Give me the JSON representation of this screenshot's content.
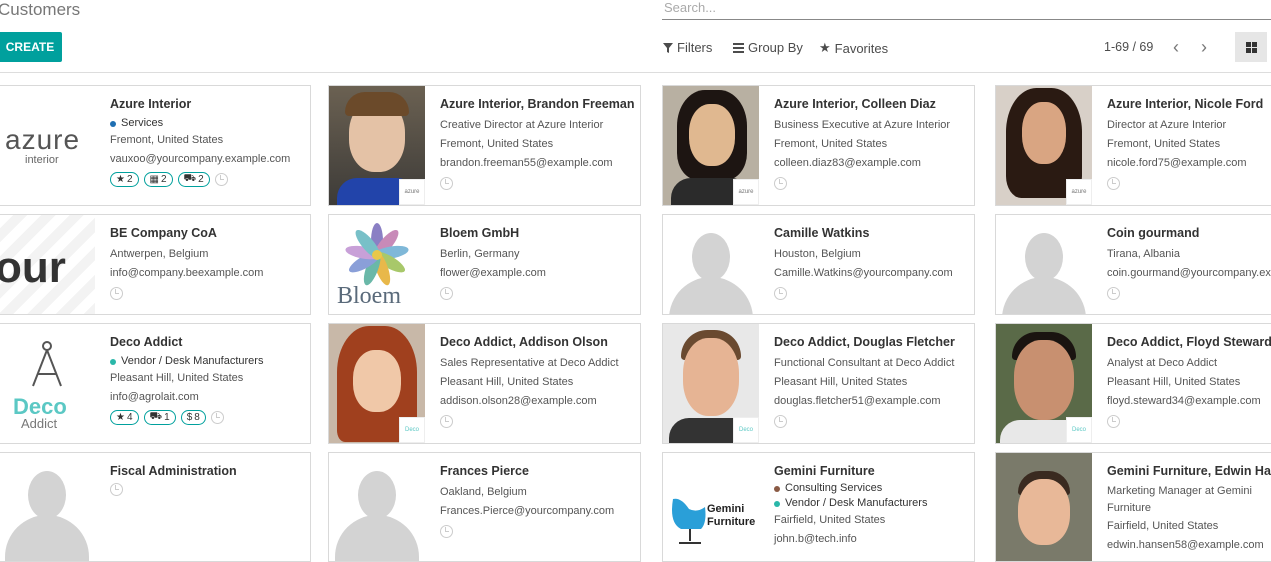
{
  "header": {
    "title": "Customers",
    "search_placeholder": "Search...",
    "create_label": "CREATE",
    "filters_label": "Filters",
    "groupby_label": "Group By",
    "favorites_label": "Favorites",
    "pager": "1-69 / 69"
  },
  "cards": [
    {
      "name": "Azure Interior",
      "tag": "Services",
      "tag_color": "#1f6fb2",
      "line1": "Fremont, United States",
      "line2": "vauxoo@yourcompany.example.com",
      "badges": [
        "2",
        "2",
        "2"
      ],
      "logo_text": "azure",
      "logo_sub": "interior"
    },
    {
      "name": "Azure Interior, Brandon Freeman",
      "line1": "Creative Director at Azure Interior",
      "line2": "Fremont, United States",
      "line3": "brandon.freeman55@example.com",
      "mini": "azure"
    },
    {
      "name": "Azure Interior, Colleen Diaz",
      "line1": "Business Executive at Azure Interior",
      "line2": "Fremont, United States",
      "line3": "colleen.diaz83@example.com",
      "mini": "azure"
    },
    {
      "name": "Azure Interior, Nicole Ford",
      "line1": "Director at Azure Interior",
      "line2": "Fremont, United States",
      "line3": "nicole.ford75@example.com",
      "mini": "azure"
    },
    {
      "name": "BE Company CoA",
      "line1": "Antwerpen, Belgium",
      "line2": "info@company.beexample.com",
      "logo_text": "our"
    },
    {
      "name": "Bloem GmbH",
      "line1": "Berlin, Germany",
      "line2": "flower@example.com",
      "logo_text": "Bloem"
    },
    {
      "name": "Camille Watkins",
      "line1": "Houston, Belgium",
      "line2": "Camille.Watkins@yourcompany.com"
    },
    {
      "name": "Coin gourmand",
      "line1": "Tirana, Albania",
      "line2": "coin.gourmand@yourcompany.example.com"
    },
    {
      "name": "Deco Addict",
      "tag": "Vendor / Desk Manufacturers",
      "tag_color": "#2ab7a9",
      "line1": "Pleasant Hill, United States",
      "line2": "info@agrolait.com",
      "badges": [
        "4",
        "1",
        "8"
      ],
      "logo_text": "Deco",
      "logo_sub": "Addict"
    },
    {
      "name": "Deco Addict, Addison Olson",
      "line1": "Sales Representative at Deco Addict",
      "line2": "Pleasant Hill, United States",
      "line3": "addison.olson28@example.com",
      "mini": "Deco"
    },
    {
      "name": "Deco Addict, Douglas Fletcher",
      "line1": "Functional Consultant at Deco Addict",
      "line2": "Pleasant Hill, United States",
      "line3": "douglas.fletcher51@example.com",
      "mini": "Deco"
    },
    {
      "name": "Deco Addict, Floyd Steward",
      "line1": "Analyst at Deco Addict",
      "line2": "Pleasant Hill, United States",
      "line3": "floyd.steward34@example.com",
      "mini": "Deco"
    },
    {
      "name": "Fiscal Administration"
    },
    {
      "name": "Frances Pierce",
      "line1": "Oakland, Belgium",
      "line2": "Frances.Pierce@yourcompany.com"
    },
    {
      "name": "Gemini Furniture",
      "tag": "Consulting Services",
      "tag_color": "#8a5a44",
      "tag2": "Vendor / Desk Manufacturers",
      "tag2_color": "#2ab7a9",
      "line1": "Fairfield, United States",
      "line2": "john.b@tech.info",
      "logo_text": "Gemini",
      "logo_sub": "Furniture"
    },
    {
      "name": "Gemini Furniture, Edwin Hansen",
      "line1": "Marketing Manager at Gemini",
      "line1b": "Furniture",
      "line2": "Fairfield, United States",
      "line3": "edwin.hansen58@example.com"
    }
  ]
}
